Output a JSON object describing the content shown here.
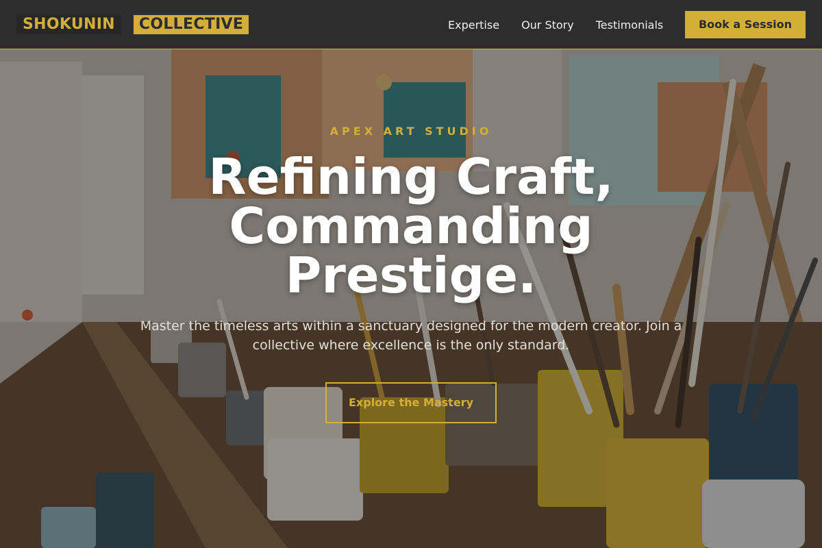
{
  "colors": {
    "accent_gold": "#d4af37",
    "nav_background": "#2d2d2d",
    "headline_text": "#ffffff"
  },
  "navbar": {
    "brand": {
      "part_1": "SHOKUNIN",
      "part_2": "COLLECTIVE"
    },
    "links": [
      {
        "label": "Expertise"
      },
      {
        "label": "Our Story"
      },
      {
        "label": "Testimonials"
      }
    ],
    "cta_label": "Book a Session"
  },
  "hero": {
    "background_image": "art-studio-brushes-and-paint-cans",
    "eyebrow": "APEX ART STUDIO",
    "headline": "Refining Craft, Commanding Prestige.",
    "subtext": "Master the timeless arts within a sanctuary designed for the modern creator. Join a collective where excellence is the only standard.",
    "cta_label": "Explore the Mastery"
  }
}
